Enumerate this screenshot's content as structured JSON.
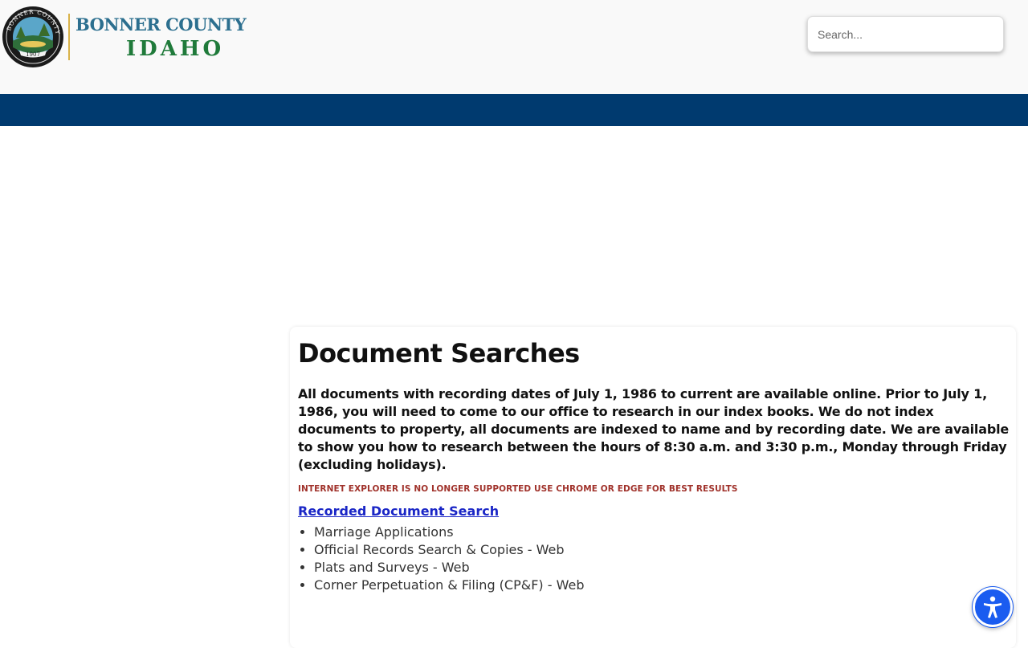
{
  "header": {
    "logo": {
      "line1": "BONNER COUNTY",
      "line2": "IDAHO",
      "seal_text": "BONNER COUNTY",
      "seal_year": "1907"
    },
    "search": {
      "placeholder": "Search..."
    }
  },
  "main": {
    "title": "Document Searches",
    "intro": "All documents with recording dates of July 1, 1986 to current are available online.  Prior to July 1, 1986, you will need to come to our office to research in our index books.  We do not index documents to property, all documents are indexed to name and by recording date.  We are available to show you how to research between the hours of 8:30 a.m. and 3:30 p.m., Monday through Friday (excluding holidays).",
    "warning": "INTERNET EXPLORER IS NO LONGER SUPPORTED USE CHROME OR EDGE FOR BEST RESULTS",
    "link_label": "Recorded Document Search",
    "items": [
      "Marriage Applications",
      "Official Records Search & Copies - Web",
      "Plats and Surveys - Web",
      "Corner Perpetuation & Filing (CP&F) - Web"
    ]
  },
  "colors": {
    "nav_bar": "#003a6f",
    "logo_blue": "#2c6f8f",
    "logo_green": "#1f7a3a",
    "warning_red": "#a0322b",
    "link_blue": "#1a26c6",
    "accessibility_blue": "#1a5cf0"
  },
  "icons": {
    "accessibility": "accessibility-icon",
    "seal": "county-seal-icon"
  }
}
